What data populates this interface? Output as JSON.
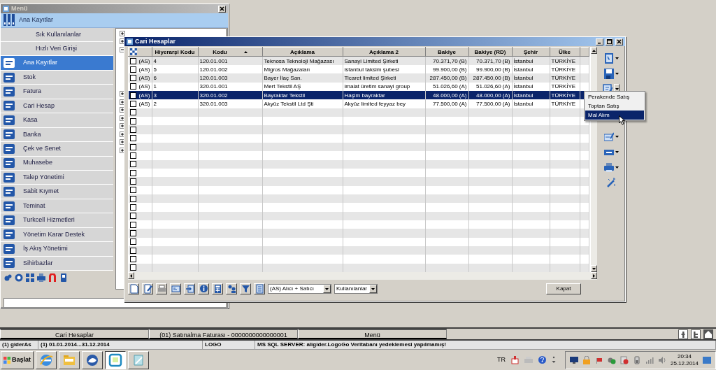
{
  "menu_window": {
    "title": "Menü",
    "header": "Ana Kayıtlar",
    "items": [
      {
        "label": "Sık Kullanılanlar",
        "kind": "plain",
        "selected": false
      },
      {
        "label": "Hızlı Veri Girişi",
        "kind": "plain",
        "selected": false
      },
      {
        "label": "Ana Kayıtlar",
        "kind": "icon",
        "selected": true
      },
      {
        "label": "Stok",
        "kind": "icon",
        "selected": false
      },
      {
        "label": "Fatura",
        "kind": "icon",
        "selected": false
      },
      {
        "label": "Cari Hesap",
        "kind": "icon",
        "selected": false
      },
      {
        "label": "Kasa",
        "kind": "icon",
        "selected": false
      },
      {
        "label": "Banka",
        "kind": "icon",
        "selected": false
      },
      {
        "label": "Çek ve Senet",
        "kind": "icon",
        "selected": false
      },
      {
        "label": "Muhasebe",
        "kind": "icon",
        "selected": false
      },
      {
        "label": "Talep Yönetimi",
        "kind": "icon",
        "selected": false
      },
      {
        "label": "Sabit Kıymet",
        "kind": "icon",
        "selected": false
      },
      {
        "label": "Teminat",
        "kind": "icon",
        "selected": false
      },
      {
        "label": "Turkcell Hizmetleri",
        "kind": "icon",
        "selected": false
      },
      {
        "label": "Yönetim Karar Destek",
        "kind": "icon",
        "selected": false
      },
      {
        "label": "İş Akış Yönetimi",
        "kind": "icon",
        "selected": false
      },
      {
        "label": "Sihirbazlar",
        "kind": "icon",
        "selected": false
      }
    ]
  },
  "records_window": {
    "title": "Cari Hesaplar",
    "columns": [
      {
        "label": "Hiyerarşi Kodu",
        "sorted": false
      },
      {
        "label": "Kodu",
        "sorted": true
      },
      {
        "label": "Açıklama",
        "sorted": false
      },
      {
        "label": "Açıklama 2",
        "sorted": false
      },
      {
        "label": "Bakiye",
        "sorted": false
      },
      {
        "label": "Bakiye (RD)",
        "sorted": false
      },
      {
        "label": "Şehir",
        "sorted": false
      },
      {
        "label": "Ülke",
        "sorted": false
      }
    ],
    "rows": [
      {
        "checked": false,
        "selected": false,
        "cells": [
          "(AS)",
          "4",
          "120.01.001",
          "Teknosa Teknoloji Mağazası",
          "Sanayi Limited Şirketi",
          "70.371,70 (B)",
          "70.371,70 (B)",
          "İstanbul",
          "TÜRKİYE"
        ]
      },
      {
        "checked": false,
        "selected": false,
        "cells": [
          "(AS)",
          "5",
          "120.01.002",
          "Migros Mağazaları",
          "istanbul taksim şubesi",
          "99.900,00 (B)",
          "99.900,00 (B)",
          "İstanbul",
          "TÜRKİYE"
        ]
      },
      {
        "checked": false,
        "selected": false,
        "cells": [
          "(AS)",
          "6",
          "120.01.003",
          "Bayer İlaç San.",
          "Ticaret limited Şirketi",
          "287.450,00 (B)",
          "287.450,00 (B)",
          "İstanbul",
          "TÜRKİYE"
        ]
      },
      {
        "checked": false,
        "selected": false,
        "cells": [
          "(AS)",
          "1",
          "320.01.001",
          "Mert Tekstil AŞ",
          "imalat üretim sanayi group",
          "51.026,60 (A)",
          "51.026,60 (A)",
          "İstanbul",
          "TÜRKİYE"
        ]
      },
      {
        "checked": false,
        "selected": true,
        "cells": [
          "(AS)",
          "3",
          "320.01.002",
          "Bayraktar Tekstil",
          "Haşim bayraktar",
          "48.000,00 (A)",
          "48.000,00 (A)",
          "İstanbul",
          "TÜRKİYE"
        ]
      },
      {
        "checked": false,
        "selected": false,
        "cells": [
          "(AS)",
          "2",
          "320.01.003",
          "Akyüz Tekstil Ltd Şti",
          "Akyüz limited feyyaz bey",
          "77.500,00 (A)",
          "77.500,00 (A)",
          "İstanbul",
          "TÜRKİYE"
        ]
      },
      {
        "checked": false,
        "selected": false
      },
      {
        "checked": false,
        "selected": false
      },
      {
        "checked": false,
        "selected": false
      },
      {
        "checked": false,
        "selected": false
      },
      {
        "checked": false,
        "selected": false
      },
      {
        "checked": false,
        "selected": false
      },
      {
        "checked": false,
        "selected": false
      },
      {
        "checked": false,
        "selected": false
      },
      {
        "checked": false,
        "selected": false
      },
      {
        "checked": false,
        "selected": false
      },
      {
        "checked": false,
        "selected": false
      },
      {
        "checked": false,
        "selected": false
      },
      {
        "checked": false,
        "selected": false
      },
      {
        "checked": false,
        "selected": false
      },
      {
        "checked": false,
        "selected": false
      },
      {
        "checked": false,
        "selected": false
      },
      {
        "checked": false,
        "selected": false
      },
      {
        "checked": false,
        "selected": false
      },
      {
        "checked": false,
        "selected": false
      }
    ],
    "invoice_menu": [
      {
        "label": "Perakende Satış",
        "selected": false
      },
      {
        "label": "Toptan Satış",
        "selected": false
      },
      {
        "label": "Mal Alım",
        "selected": true
      }
    ],
    "filters": [
      {
        "value": "(AS) Alıcı + Satıcı"
      },
      {
        "value": "Kullanılanlar"
      }
    ],
    "close_button": "Kapat"
  },
  "window_tabs": [
    {
      "label": "Cari Hesaplar"
    },
    {
      "label": "(01) Satınalma Faturası - 0000000000000001"
    },
    {
      "label": "Menü"
    }
  ],
  "status_bar": [
    "(1) giderAs",
    "(1) 01.01.2014...31.12.2014",
    "LOGO",
    "MS SQL SERVER: aligider.LogoGo Veritabanı yedeklemesi yapılmamış!"
  ],
  "taskbar": {
    "start": "Başlat",
    "apps": [
      {
        "selected": false
      },
      {
        "selected": false
      },
      {
        "selected": false
      },
      {
        "selected": true
      },
      {
        "selected": false
      }
    ],
    "language": "TR",
    "time": "20:34",
    "date": "25.12.2014"
  }
}
